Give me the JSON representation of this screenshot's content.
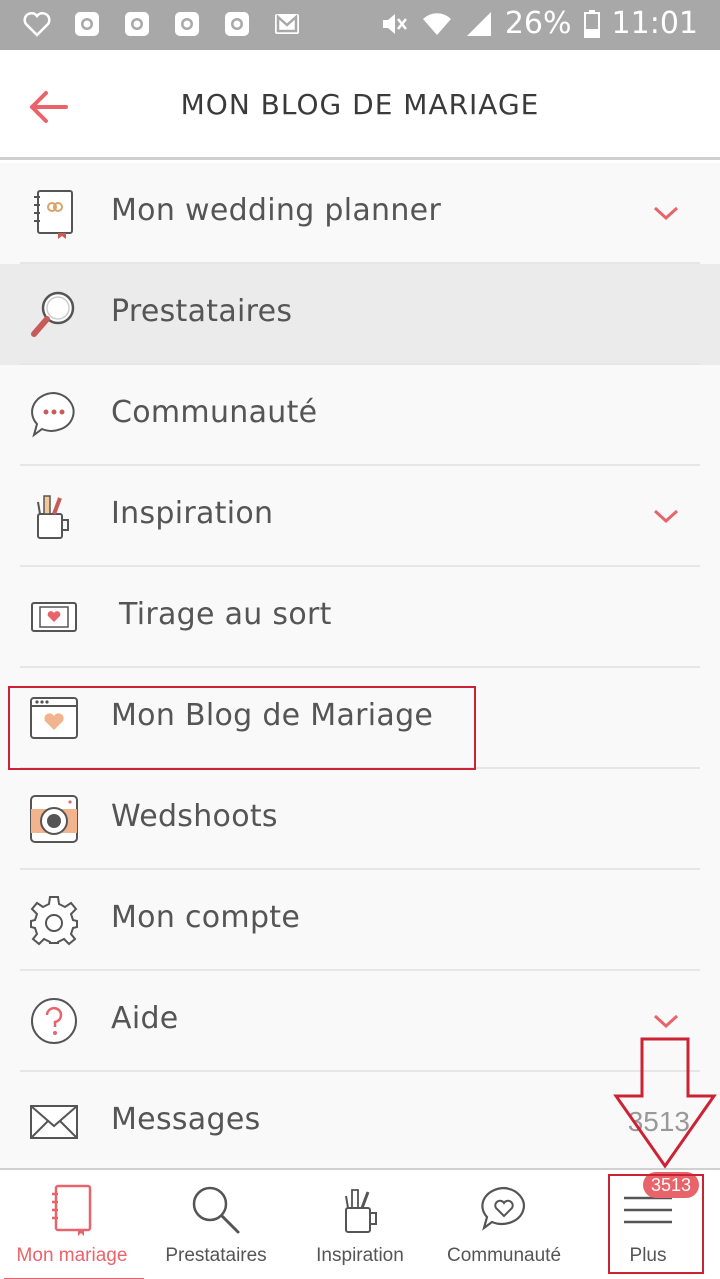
{
  "status": {
    "battery": "26%",
    "time": "11:01"
  },
  "appbar": {
    "title": "MON BLOG DE MARIAGE"
  },
  "menu": [
    {
      "label": "Mon wedding planner",
      "icon": "planner-icon",
      "expandable": true
    },
    {
      "label": "Prestataires",
      "icon": "magnifier-icon",
      "expandable": false,
      "highlighted": true
    },
    {
      "label": "Communauté",
      "icon": "chat-bubble-icon",
      "expandable": false
    },
    {
      "label": "Inspiration",
      "icon": "paint-cup-icon",
      "expandable": true
    },
    {
      "label": "Tirage au sort",
      "icon": "ticket-icon",
      "expandable": false
    },
    {
      "label": "Mon Blog de Mariage",
      "icon": "blog-window-icon",
      "expandable": false,
      "selected": true
    },
    {
      "label": "Wedshoots",
      "icon": "camera-icon",
      "expandable": false
    },
    {
      "label": "Mon compte",
      "icon": "gear-icon",
      "expandable": false
    },
    {
      "label": "Aide",
      "icon": "help-icon",
      "expandable": true
    },
    {
      "label": "Messages",
      "icon": "envelope-icon",
      "expandable": false,
      "count": "3513"
    }
  ],
  "bottomnav": {
    "tabs": [
      {
        "label": "Mon mariage",
        "icon": "notebook-icon",
        "active": true
      },
      {
        "label": "Prestataires",
        "icon": "search-icon"
      },
      {
        "label": "Inspiration",
        "icon": "paint-cup-icon"
      },
      {
        "label": "Communauté",
        "icon": "heart-bubble-icon"
      },
      {
        "label": "Plus",
        "icon": "hamburger-icon",
        "badge": "3513"
      }
    ]
  },
  "colors": {
    "accent": "#e8646a",
    "annotation": "#cc2233",
    "statusbar": "#a8a8a8"
  }
}
